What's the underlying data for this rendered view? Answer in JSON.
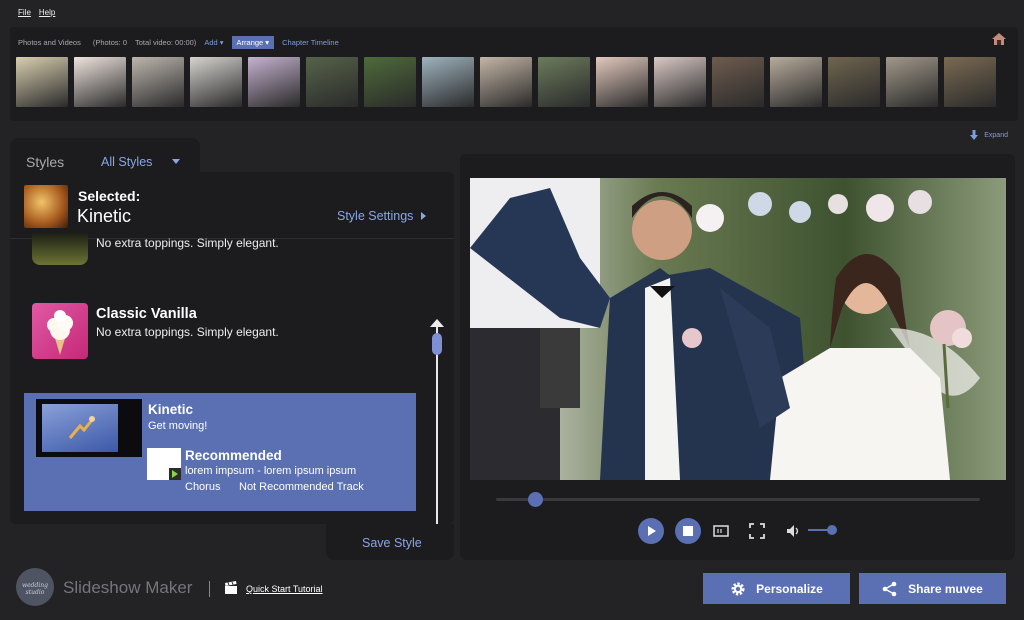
{
  "menu": {
    "file": "File",
    "help": "Help"
  },
  "strip": {
    "title": "Photos and Videos",
    "photos_count": "(Photos: 0",
    "total_video": "Total video: 00:00)",
    "add": "Add",
    "arrange": "Arrange",
    "chapter": "Chapter Timeline",
    "expand": "Expand",
    "thumb_colors": [
      "#d9cfb0",
      "#efe4de",
      "#bdb6ae",
      "#d6d3cf",
      "#c5b2cf",
      "#56634a",
      "#4e6b3b",
      "#9fb3be",
      "#c4b5a6",
      "#6c7b5d",
      "#e2c9bd",
      "#d8c8c4",
      "#6e5c4e",
      "#b7ab9c",
      "#6f654f",
      "#a1988a",
      "#7a6a53"
    ]
  },
  "styles": {
    "tab_label": "Styles",
    "filter": "All Styles",
    "selected_label": "Selected:",
    "selected_value": "Kinetic",
    "style_settings": "Style Settings",
    "items": [
      {
        "desc": "No extra toppings. Simply elegant."
      },
      {
        "name": "Classic Vanilla",
        "desc": "No extra toppings. Simply elegant."
      },
      {
        "name": "Kinetic",
        "desc": "Get moving!",
        "recommended": "Recommended",
        "track": "lorem impsum - lorem ipsum ipsum",
        "chorus": "Chorus",
        "not_recommended": "Not Recommended Track"
      }
    ],
    "save_style": "Save Style"
  },
  "preview": {
    "seek_position": 0.08,
    "volume": 0.85
  },
  "footer": {
    "logo_text": "wedding studio",
    "app_name": "Slideshow Maker",
    "divider": "|",
    "tutorial": "Quick Start Tutorial",
    "personalize": "Personalize",
    "share": "Share muvee"
  },
  "colors": {
    "accent": "#5a70b2",
    "link": "#8aa6e8",
    "panel": "#1c1c1e",
    "background": "#232325"
  }
}
